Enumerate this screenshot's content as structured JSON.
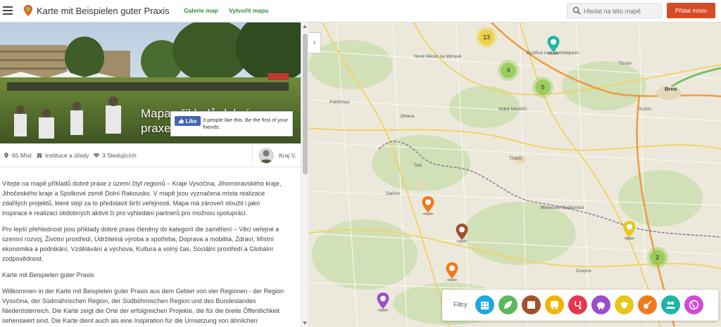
{
  "header": {
    "title": "Karte mit Beispielen guter Praxis",
    "nav": [
      "Galerie map",
      "Vytvořit mapu"
    ],
    "search_placeholder": "Hledat na této mapě",
    "add_place": "Přidat místo",
    "add_color": "#d64a24",
    "nav_color": "#2e8b3c"
  },
  "hero": {
    "title": "Mapa příkladů dobré praxe",
    "facebook": {
      "like_label": "Like",
      "text": "3 people like this. Be the first of your friends."
    }
  },
  "stats": {
    "places": "65 Míst",
    "type": "Instituce a úřady",
    "followers": "3 Sledujících",
    "author": "Kraj V."
  },
  "description": [
    "Vítejte na mapě příkladů dobré praxe z území čtyř regionů – Kraje Vysočina, Jihomoravského kraje, Jihočeského kraje a Spolkové země Dolní Rakousko. V mapě jsou vyznačena místa realizace zdařilých projektů, které stojí za to představit širší veřejnosti. Mapa má zároveň sloužit i jako inspirace k realizaci obdobných aktivit či pro vyhledání partnerů pro možnou spolupráci.",
    "Pro lepší přehlednost jsou příklady dobré praxe členěny do kategorií dle zaměření – Věci veřejné a územní rozvoj, Životní prostředí, Udržitelná výroba a spotřeba, Doprava a mobilita, Zdraví, Místní ekonomika a podnikání, Vzdělávání a výchova, Kultura a volný čas, Sociální prostředí a Globální zodpovědnost.",
    "Karte mit Beispielen guter Praxis",
    "Willkommen in der Karte mit Beispielen guter Praxis aus dem Gebiet von vier Regionen - der Region Vysočina, der Südmährischen Region, der Südböhmischen Region und des Bundeslandes Niederösterreich. Die Karte zeigt die Orte der erfolgreichen Projekte, die für die breite Öffentlichkeit sehenswert sind. Die Karte dient auch als eine Inspiration für die Umsetzung von ähnlichen"
  ],
  "map": {
    "clusters": [
      {
        "count": "13",
        "color": "yellow"
      },
      {
        "count": "4",
        "color": "green"
      },
      {
        "count": "5",
        "color": "green"
      },
      {
        "count": "2",
        "color": "green"
      }
    ],
    "labels": [
      "Brno",
      "Nové Město na Moravě",
      "Bystřice nad Pernštejnem",
      "Velké Meziříčí",
      "Třebíč",
      "Jihlava",
      "Pelhřimov",
      "Telč",
      "Dačice",
      "Moravské Budějovice",
      "Znojmo",
      "Tišnov",
      "Kuřim"
    ],
    "filters_label": "Filtry",
    "filters": [
      {
        "name": "public-affairs",
        "color": "#1ea7e1"
      },
      {
        "name": "environment",
        "color": "#5cb85c"
      },
      {
        "name": "sustainable-production",
        "color": "#a0522d"
      },
      {
        "name": "transport",
        "color": "#f0b400"
      },
      {
        "name": "health",
        "color": "#e8364f"
      },
      {
        "name": "local-economy",
        "color": "#9b4dca"
      },
      {
        "name": "education",
        "color": "#e6c619"
      },
      {
        "name": "culture",
        "color": "#f07a1a"
      },
      {
        "name": "social",
        "color": "#1fb5a5"
      },
      {
        "name": "global",
        "color": "#d24bd6"
      }
    ]
  }
}
